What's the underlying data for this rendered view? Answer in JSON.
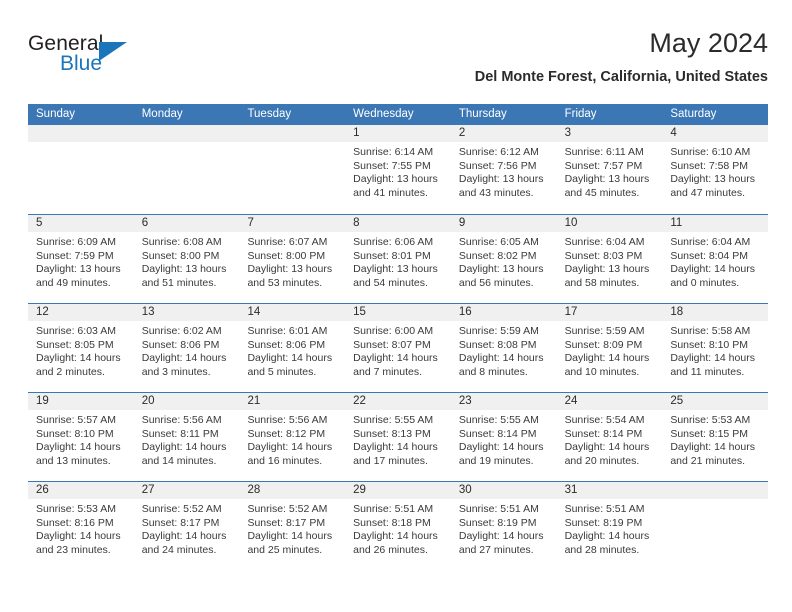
{
  "brand": {
    "line1": "General",
    "line2": "Blue",
    "accent_color": "#1b75bb",
    "triangle_icon": "brand-triangle-icon"
  },
  "header": {
    "title": "May 2024",
    "subtitle": "Del Monte Forest, California, United States"
  },
  "theme": {
    "header_blue": "#3b77b5",
    "daynum_bg": "#f0f0f0",
    "text": "#2b2b2b"
  },
  "weekdays": [
    "Sunday",
    "Monday",
    "Tuesday",
    "Wednesday",
    "Thursday",
    "Friday",
    "Saturday"
  ],
  "labels": {
    "sunrise": "Sunrise:",
    "sunset": "Sunset:",
    "daylight": "Daylight:"
  },
  "weeks": [
    [
      {
        "day": "",
        "sunrise": "",
        "sunset": "",
        "daylight": ""
      },
      {
        "day": "",
        "sunrise": "",
        "sunset": "",
        "daylight": ""
      },
      {
        "day": "",
        "sunrise": "",
        "sunset": "",
        "daylight": ""
      },
      {
        "day": "1",
        "sunrise": "Sunrise: 6:14 AM",
        "sunset": "Sunset: 7:55 PM",
        "daylight": "Daylight: 13 hours and 41 minutes."
      },
      {
        "day": "2",
        "sunrise": "Sunrise: 6:12 AM",
        "sunset": "Sunset: 7:56 PM",
        "daylight": "Daylight: 13 hours and 43 minutes."
      },
      {
        "day": "3",
        "sunrise": "Sunrise: 6:11 AM",
        "sunset": "Sunset: 7:57 PM",
        "daylight": "Daylight: 13 hours and 45 minutes."
      },
      {
        "day": "4",
        "sunrise": "Sunrise: 6:10 AM",
        "sunset": "Sunset: 7:58 PM",
        "daylight": "Daylight: 13 hours and 47 minutes."
      }
    ],
    [
      {
        "day": "5",
        "sunrise": "Sunrise: 6:09 AM",
        "sunset": "Sunset: 7:59 PM",
        "daylight": "Daylight: 13 hours and 49 minutes."
      },
      {
        "day": "6",
        "sunrise": "Sunrise: 6:08 AM",
        "sunset": "Sunset: 8:00 PM",
        "daylight": "Daylight: 13 hours and 51 minutes."
      },
      {
        "day": "7",
        "sunrise": "Sunrise: 6:07 AM",
        "sunset": "Sunset: 8:00 PM",
        "daylight": "Daylight: 13 hours and 53 minutes."
      },
      {
        "day": "8",
        "sunrise": "Sunrise: 6:06 AM",
        "sunset": "Sunset: 8:01 PM",
        "daylight": "Daylight: 13 hours and 54 minutes."
      },
      {
        "day": "9",
        "sunrise": "Sunrise: 6:05 AM",
        "sunset": "Sunset: 8:02 PM",
        "daylight": "Daylight: 13 hours and 56 minutes."
      },
      {
        "day": "10",
        "sunrise": "Sunrise: 6:04 AM",
        "sunset": "Sunset: 8:03 PM",
        "daylight": "Daylight: 13 hours and 58 minutes."
      },
      {
        "day": "11",
        "sunrise": "Sunrise: 6:04 AM",
        "sunset": "Sunset: 8:04 PM",
        "daylight": "Daylight: 14 hours and 0 minutes."
      }
    ],
    [
      {
        "day": "12",
        "sunrise": "Sunrise: 6:03 AM",
        "sunset": "Sunset: 8:05 PM",
        "daylight": "Daylight: 14 hours and 2 minutes."
      },
      {
        "day": "13",
        "sunrise": "Sunrise: 6:02 AM",
        "sunset": "Sunset: 8:06 PM",
        "daylight": "Daylight: 14 hours and 3 minutes."
      },
      {
        "day": "14",
        "sunrise": "Sunrise: 6:01 AM",
        "sunset": "Sunset: 8:06 PM",
        "daylight": "Daylight: 14 hours and 5 minutes."
      },
      {
        "day": "15",
        "sunrise": "Sunrise: 6:00 AM",
        "sunset": "Sunset: 8:07 PM",
        "daylight": "Daylight: 14 hours and 7 minutes."
      },
      {
        "day": "16",
        "sunrise": "Sunrise: 5:59 AM",
        "sunset": "Sunset: 8:08 PM",
        "daylight": "Daylight: 14 hours and 8 minutes."
      },
      {
        "day": "17",
        "sunrise": "Sunrise: 5:59 AM",
        "sunset": "Sunset: 8:09 PM",
        "daylight": "Daylight: 14 hours and 10 minutes."
      },
      {
        "day": "18",
        "sunrise": "Sunrise: 5:58 AM",
        "sunset": "Sunset: 8:10 PM",
        "daylight": "Daylight: 14 hours and 11 minutes."
      }
    ],
    [
      {
        "day": "19",
        "sunrise": "Sunrise: 5:57 AM",
        "sunset": "Sunset: 8:10 PM",
        "daylight": "Daylight: 14 hours and 13 minutes."
      },
      {
        "day": "20",
        "sunrise": "Sunrise: 5:56 AM",
        "sunset": "Sunset: 8:11 PM",
        "daylight": "Daylight: 14 hours and 14 minutes."
      },
      {
        "day": "21",
        "sunrise": "Sunrise: 5:56 AM",
        "sunset": "Sunset: 8:12 PM",
        "daylight": "Daylight: 14 hours and 16 minutes."
      },
      {
        "day": "22",
        "sunrise": "Sunrise: 5:55 AM",
        "sunset": "Sunset: 8:13 PM",
        "daylight": "Daylight: 14 hours and 17 minutes."
      },
      {
        "day": "23",
        "sunrise": "Sunrise: 5:55 AM",
        "sunset": "Sunset: 8:14 PM",
        "daylight": "Daylight: 14 hours and 19 minutes."
      },
      {
        "day": "24",
        "sunrise": "Sunrise: 5:54 AM",
        "sunset": "Sunset: 8:14 PM",
        "daylight": "Daylight: 14 hours and 20 minutes."
      },
      {
        "day": "25",
        "sunrise": "Sunrise: 5:53 AM",
        "sunset": "Sunset: 8:15 PM",
        "daylight": "Daylight: 14 hours and 21 minutes."
      }
    ],
    [
      {
        "day": "26",
        "sunrise": "Sunrise: 5:53 AM",
        "sunset": "Sunset: 8:16 PM",
        "daylight": "Daylight: 14 hours and 23 minutes."
      },
      {
        "day": "27",
        "sunrise": "Sunrise: 5:52 AM",
        "sunset": "Sunset: 8:17 PM",
        "daylight": "Daylight: 14 hours and 24 minutes."
      },
      {
        "day": "28",
        "sunrise": "Sunrise: 5:52 AM",
        "sunset": "Sunset: 8:17 PM",
        "daylight": "Daylight: 14 hours and 25 minutes."
      },
      {
        "day": "29",
        "sunrise": "Sunrise: 5:51 AM",
        "sunset": "Sunset: 8:18 PM",
        "daylight": "Daylight: 14 hours and 26 minutes."
      },
      {
        "day": "30",
        "sunrise": "Sunrise: 5:51 AM",
        "sunset": "Sunset: 8:19 PM",
        "daylight": "Daylight: 14 hours and 27 minutes."
      },
      {
        "day": "31",
        "sunrise": "Sunrise: 5:51 AM",
        "sunset": "Sunset: 8:19 PM",
        "daylight": "Daylight: 14 hours and 28 minutes."
      },
      {
        "day": "",
        "sunrise": "",
        "sunset": "",
        "daylight": ""
      }
    ]
  ]
}
